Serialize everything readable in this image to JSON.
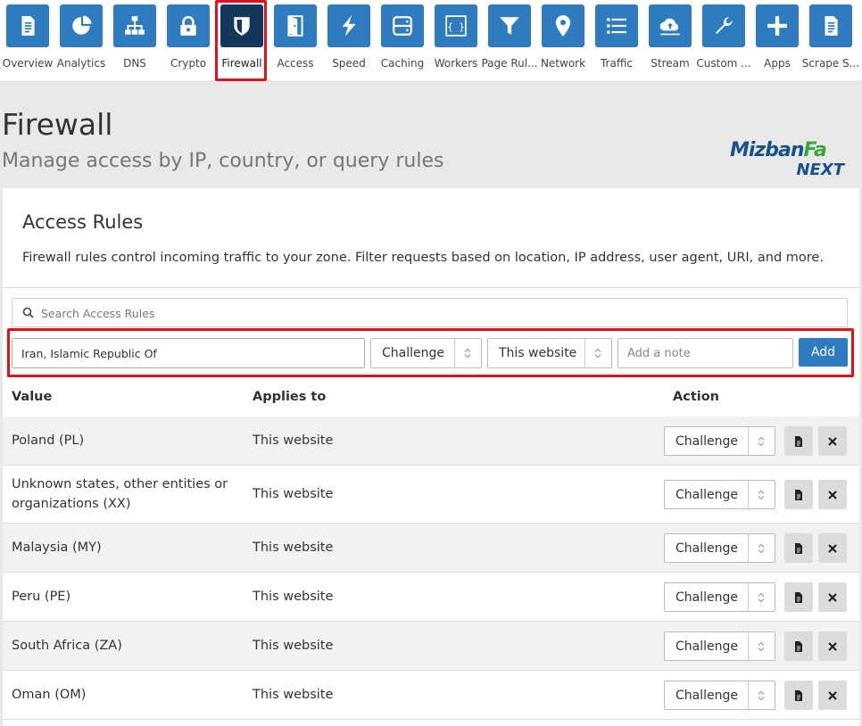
{
  "nav": {
    "items": [
      {
        "label": "Overview",
        "icon": "document-icon"
      },
      {
        "label": "Analytics",
        "icon": "pie-chart-icon"
      },
      {
        "label": "DNS",
        "icon": "network-icon"
      },
      {
        "label": "Crypto",
        "icon": "lock-icon"
      },
      {
        "label": "Firewall",
        "icon": "shield-icon",
        "active": true
      },
      {
        "label": "Access",
        "icon": "door-icon"
      },
      {
        "label": "Speed",
        "icon": "lightning-icon"
      },
      {
        "label": "Caching",
        "icon": "server-icon"
      },
      {
        "label": "Workers",
        "icon": "code-braces-icon"
      },
      {
        "label": "Page Rul...",
        "icon": "filter-icon"
      },
      {
        "label": "Network",
        "icon": "location-pin-icon"
      },
      {
        "label": "Traffic",
        "icon": "list-icon"
      },
      {
        "label": "Stream",
        "icon": "cloud-upload-icon"
      },
      {
        "label": "Custom ...",
        "icon": "wrench-icon"
      },
      {
        "label": "Apps",
        "icon": "plus-icon"
      },
      {
        "label": "Scrape S...",
        "icon": "document-icon"
      }
    ]
  },
  "header": {
    "title": "Firewall",
    "subtitle": "Manage access by IP, country, or query rules"
  },
  "logo": {
    "brand_main": "Mizban",
    "brand_accent": "Fa",
    "brand_sub": "NEXT"
  },
  "access_rules": {
    "title": "Access Rules",
    "description": "Firewall rules control incoming traffic to your zone. Filter requests based on location, IP address, user agent, URI, and more.",
    "search_placeholder": "Search Access Rules",
    "form": {
      "value": "Iran, Islamic Republic Of",
      "action": "Challenge",
      "scope": "This website",
      "note_placeholder": "Add a note",
      "add_label": "Add"
    },
    "columns": {
      "value": "Value",
      "applies_to": "Applies to",
      "action": "Action"
    },
    "rows": [
      {
        "value": "Poland (PL)",
        "applies_to": "This website",
        "action": "Challenge"
      },
      {
        "value": "Unknown states, other entities or organizations (XX)",
        "applies_to": "This website",
        "action": "Challenge"
      },
      {
        "value": "Malaysia (MY)",
        "applies_to": "This website",
        "action": "Challenge"
      },
      {
        "value": "Peru (PE)",
        "applies_to": "This website",
        "action": "Challenge"
      },
      {
        "value": "South Africa (ZA)",
        "applies_to": "This website",
        "action": "Challenge"
      },
      {
        "value": "Oman (OM)",
        "applies_to": "This website",
        "action": "Challenge"
      }
    ]
  },
  "colors": {
    "tile": "#2f7bbf",
    "tile_active": "#14385c",
    "highlight": "#e0101a",
    "add_button": "#2f7bbf"
  }
}
